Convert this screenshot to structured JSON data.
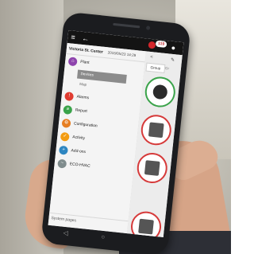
{
  "status_bar": {
    "alert_count": "119"
  },
  "drawer": {
    "site_name": "Victoria St. Center",
    "timestamp": "2016/05/23 14:29",
    "items": [
      {
        "label": "Plant",
        "color": "#8e44ad",
        "icon": "plant-icon"
      },
      {
        "label": "Alarms",
        "color": "#e03c31",
        "icon": "alarm-icon"
      },
      {
        "label": "Report",
        "color": "#3aa34a",
        "icon": "report-icon"
      },
      {
        "label": "Configuration",
        "color": "#e67e22",
        "icon": "configuration-icon"
      },
      {
        "label": "Activity",
        "color": "#f39c12",
        "icon": "activity-icon"
      },
      {
        "label": "Add-ons",
        "color": "#2e86c1",
        "icon": "add-ons-icon"
      },
      {
        "label": "ECO-HVAC",
        "color": "#7f8c8d",
        "icon": "eco-hvac-icon"
      }
    ],
    "plant_subitems": [
      {
        "label": "Devices",
        "active": true
      },
      {
        "label": "Map",
        "active": false
      }
    ],
    "system_pages_label": "System pages"
  },
  "content": {
    "tabs": [
      {
        "label": "Group"
      },
      {
        "label": "Gr"
      }
    ]
  }
}
